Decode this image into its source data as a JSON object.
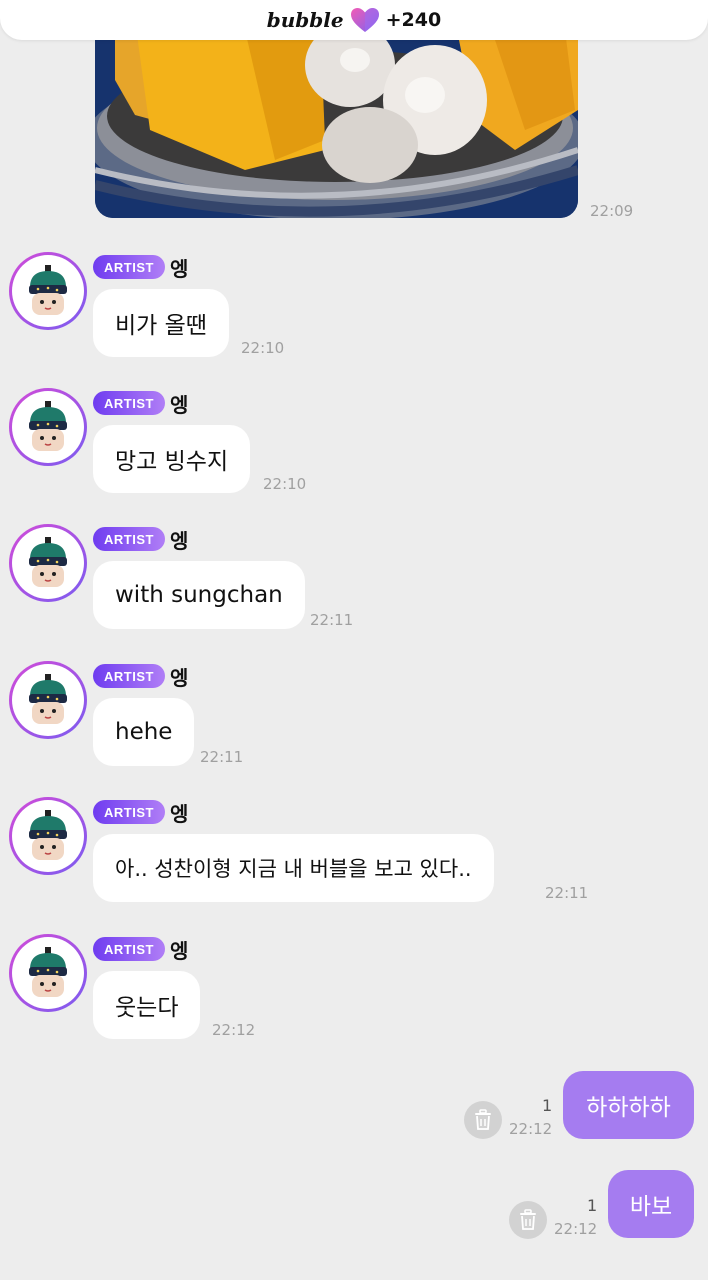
{
  "header": {
    "brand": "bubble",
    "heart_icon": "heart-icon",
    "count": "+240"
  },
  "photo_message": {
    "time": "22:09",
    "image_icon": "dessert-photo"
  },
  "artist_messages": [
    {
      "badge": "ARTIST",
      "name": "엥",
      "text": "비가 올땐",
      "time": "22:10"
    },
    {
      "badge": "ARTIST",
      "name": "엥",
      "text": "망고 빙수지",
      "time": "22:10"
    },
    {
      "badge": "ARTIST",
      "name": "엥",
      "text": "with sungchan",
      "time": "22:11"
    },
    {
      "badge": "ARTIST",
      "name": "엥",
      "text": "hehe",
      "time": "22:11"
    },
    {
      "badge": "ARTIST",
      "name": "엥",
      "text": "아.. 성찬이형 지금 내 버블을 보고 있다..",
      "time": "22:11"
    },
    {
      "badge": "ARTIST",
      "name": "엥",
      "text": "웃는다",
      "time": "22:12"
    }
  ],
  "own_messages": [
    {
      "text": "하하하하",
      "unread": "1",
      "time": "22:12"
    },
    {
      "text": "바보",
      "unread": "1",
      "time": "22:12"
    }
  ],
  "colors": {
    "background": "#ededed",
    "own_bubble": "#a57cf0",
    "badge_start": "#6f3cf0",
    "badge_end": "#b07ef6"
  }
}
